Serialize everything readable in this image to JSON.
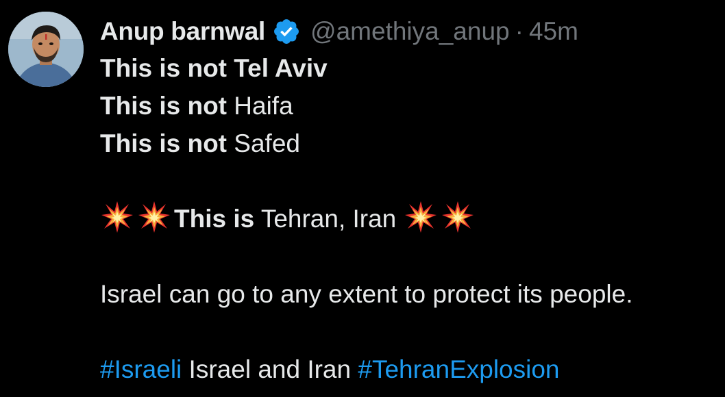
{
  "author": {
    "name": "Anup barnwal",
    "handle": "@amethiya_anup",
    "separator": "·",
    "time": "45m",
    "verified": true,
    "avatar_icon": "user-photo-avatar"
  },
  "tweet": {
    "line1_bold": "This is not Tel Aviv",
    "line2_bold": "This is not",
    "line2_text": " Haifa",
    "line3_bold": "This is not",
    "line3_text": " Safed",
    "line4_emoji_icon": "collision-emoji",
    "line4_bold": "This is",
    "line4_text": " Tehran, Iran ",
    "line5_text": "Israel can go to any extent to protect its people.",
    "hashtag1": "#Israeli",
    "line6_text": " Israel and Iran ",
    "hashtag2": "#TehranExplosion"
  },
  "colors": {
    "background": "#000000",
    "text": "#e7e9ea",
    "muted": "#71767b",
    "link": "#1d9bf0",
    "verified_badge": "#1d9bf0"
  }
}
